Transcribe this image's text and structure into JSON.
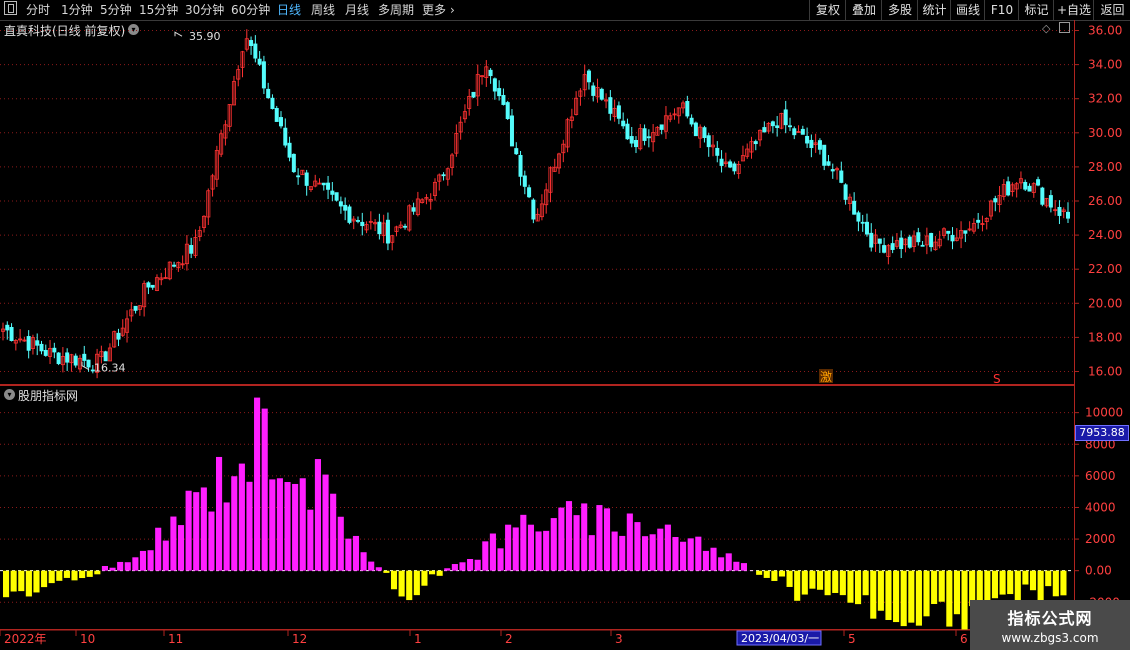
{
  "toolbar": {
    "periods": [
      "分时",
      "1分钟",
      "5分钟",
      "15分钟",
      "30分钟",
      "60分钟",
      "日线",
      "周线",
      "月线",
      "多周期",
      "更多"
    ],
    "active_period": "日线",
    "right_buttons": [
      "复权",
      "叠加",
      "多股",
      "统计",
      "画线",
      "F10",
      "标记",
      "+自选",
      "返回"
    ]
  },
  "main_chart": {
    "title": "直真科技(日线 前复权)",
    "high_label": "35.90",
    "low_label": "16.34",
    "y_axis_ticks": [
      "36.00",
      "34.00",
      "32.00",
      "30.00",
      "28.00",
      "26.00",
      "24.00",
      "22.00",
      "20.00",
      "18.00",
      "16.00"
    ],
    "markers": [
      {
        "text": "激",
        "color": "#ffa000"
      },
      {
        "text": "S",
        "color": "#ff3030"
      }
    ]
  },
  "indicator": {
    "title": "股朋指标网",
    "y_axis_ticks": [
      "10000",
      "8000",
      "6000",
      "4000",
      "2000",
      "0.00",
      "-2000"
    ],
    "last_value": "7953.88",
    "colors": {
      "positive": "#ff1fff",
      "negative": "#ffff00"
    }
  },
  "x_axis": {
    "labels": [
      "2022年",
      "10",
      "11",
      "12",
      "1",
      "2",
      "3",
      "2023/04/03/一",
      "5",
      "6"
    ]
  },
  "watermark": {
    "line1": "指标公式网",
    "line2": "www.zbgs3.com"
  },
  "colors": {
    "up": "#ff3232",
    "down": "#54fcfc",
    "grid": "#8b1a1a",
    "frame": "#b0241f",
    "axis_text": "#ff4040"
  },
  "chart_data": [
    {
      "type": "candlestick",
      "title": "直真科技(日线 前复权)",
      "ylim": [
        15.5,
        36.5
      ],
      "close_path": [
        {
          "x": "2022-09",
          "y": 18.5
        },
        {
          "x": "2022-10 early",
          "y": 17.0
        },
        {
          "x": "2022-10 mid",
          "y": 16.5
        },
        {
          "x": "2022-10 late",
          "y": 21.0
        },
        {
          "x": "2022-11 start",
          "y": 23.5
        },
        {
          "x": "2022-11 peak",
          "y": 35.9
        },
        {
          "x": "2022-11 mid",
          "y": 28.0
        },
        {
          "x": "2022-11 late",
          "y": 25.5
        },
        {
          "x": "2022-12",
          "y": 24.0
        },
        {
          "x": "2023-01 early",
          "y": 27.0
        },
        {
          "x": "2023-01 peak",
          "y": 34.5
        },
        {
          "x": "2023-01 late",
          "y": 25.0
        },
        {
          "x": "2023-02",
          "y": 33.5
        },
        {
          "x": "2023-02 late",
          "y": 29.5
        },
        {
          "x": "2023-03 mid",
          "y": 31.5
        },
        {
          "x": "2023-03 late",
          "y": 27.5
        },
        {
          "x": "2023-04 mid",
          "y": 30.8
        },
        {
          "x": "2023-05 early",
          "y": 28.5
        },
        {
          "x": "2023-05 mid",
          "y": 23.5
        },
        {
          "x": "2023-05 late",
          "y": 23.5
        },
        {
          "x": "2023-06 early",
          "y": 24.5
        },
        {
          "x": "2023-06 mid",
          "y": 27.5
        },
        {
          "x": "2023-06 late",
          "y": 25.0
        }
      ]
    },
    {
      "type": "bar",
      "title": "股朋指标网",
      "ylim": [
        -3500,
        10800
      ],
      "segments": [
        {
          "period": "2022-09",
          "approx_value": -2000
        },
        {
          "period": "2022-10 late",
          "approx_value": 800
        },
        {
          "period": "2022-11 peak",
          "approx_value": 10200
        },
        {
          "period": "2022-12",
          "approx_value": -1800
        },
        {
          "period": "2023-01 peak",
          "approx_value": 3800
        },
        {
          "period": "2023-02",
          "approx_value": 3100
        },
        {
          "period": "2023-03",
          "approx_value": -1500
        },
        {
          "period": "2023-05",
          "approx_value": -3700
        },
        {
          "period": "2023-06",
          "approx_value": -1200
        }
      ],
      "last_value": 7953.88
    }
  ]
}
